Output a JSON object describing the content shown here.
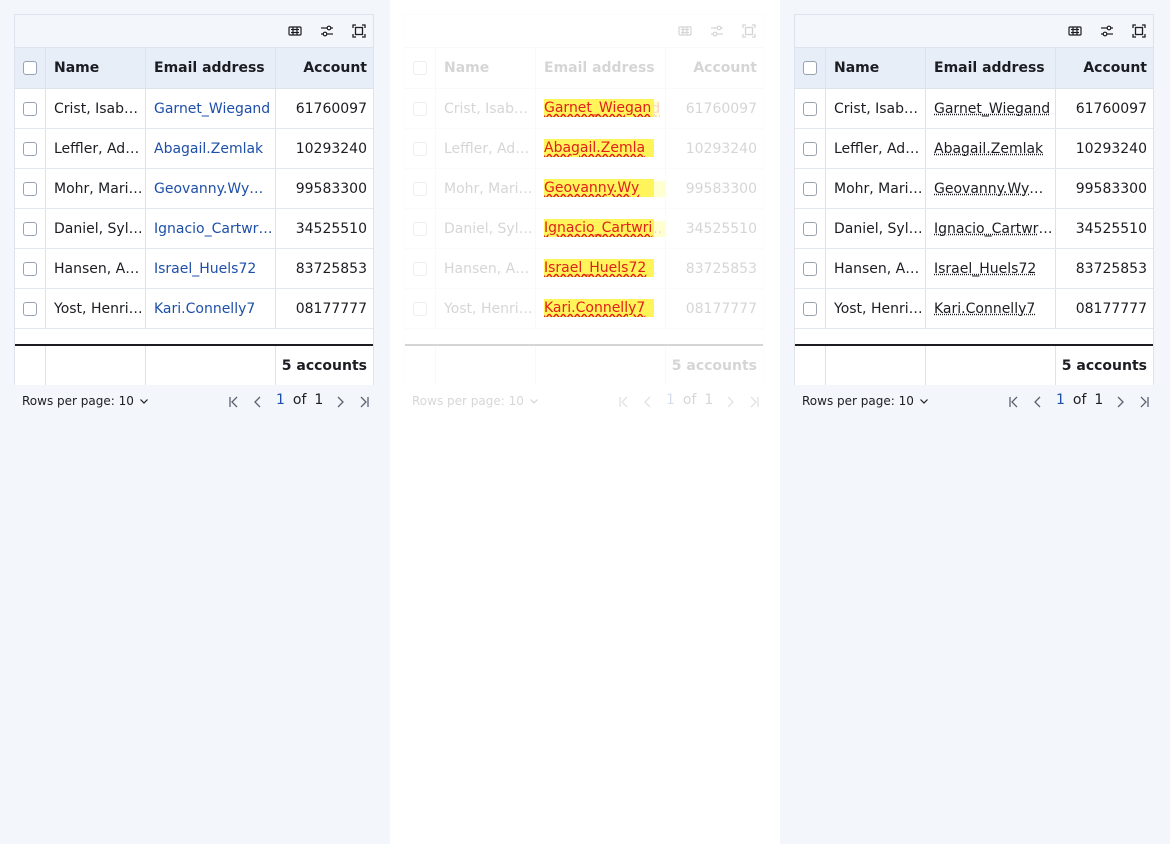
{
  "toolbar": {
    "icons": [
      "density-icon",
      "filter-icon",
      "fullscreen-icon"
    ]
  },
  "columns": {
    "name": "Name",
    "email": "Email address",
    "account": "Account"
  },
  "rows": [
    {
      "name": "Crist, Isabella",
      "email": "Garnet_Wiegand",
      "account": "61760097",
      "overlay": "Garnet_Wiegan"
    },
    {
      "name": "Leffler, Adam",
      "email": "Abagail.Zemlak",
      "account": "10293240",
      "overlay": "Abagail.Zemla"
    },
    {
      "name": "Mohr, Marilyn",
      "email": "Geovanny.Wyman",
      "account": "99583300",
      "overlay": "Geovanny.Wy"
    },
    {
      "name": "Daniel, Sylvia",
      "email": "Ignacio_Cartwright",
      "account": "34525510",
      "overlay": "Ignacio_Cartwri"
    },
    {
      "name": "Hansen, Amy",
      "email": "Israel_Huels72",
      "account": "83725853",
      "overlay": "Israel_Huels72"
    },
    {
      "name": "Yost, Henrietta",
      "email": "Kari.Connelly7",
      "account": "08177777",
      "overlay": "Kari.Connelly7"
    }
  ],
  "footer": {
    "total": "5 accounts"
  },
  "pager": {
    "rows_per_page": "Rows per page: 10",
    "current": "1",
    "of": "of",
    "total": "1"
  },
  "colors": {
    "link": "#1e4fa8",
    "header_bg": "#e8eef7",
    "border": "#dde3ec"
  }
}
